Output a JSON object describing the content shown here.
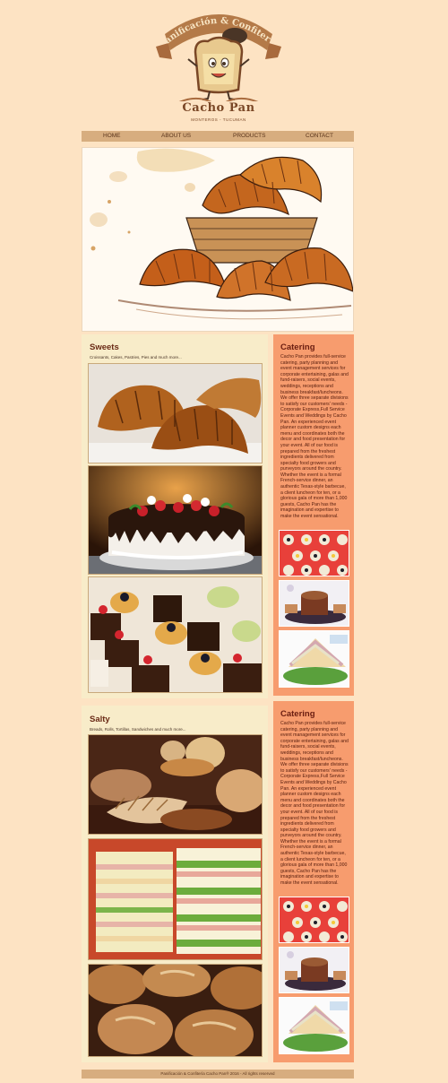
{
  "logo": {
    "arch_text": "Panificación & Confitería",
    "brand": "Cacho Pan",
    "subtitle": "MONTEROS - TUCUMAN"
  },
  "nav": [
    {
      "label": "HOME"
    },
    {
      "label": "ABOUT US"
    },
    {
      "label": "PRODUCTS"
    },
    {
      "label": "CONTACT"
    }
  ],
  "sweets": {
    "title": "Sweets",
    "intro": "Croissants, Cakes, Pastries, Pies and much more...",
    "images": [
      "croissants-photo",
      "cake-photo",
      "pastries-photo"
    ]
  },
  "salty": {
    "title": "Salty",
    "intro": "Breads, Rolls, Tortillas, Sandwiches and much more...",
    "images": [
      "breads-photo",
      "sandwiches-photo",
      "rolls-photo"
    ]
  },
  "catering_1": {
    "title": "Catering",
    "body": "Cacho Pan provides full-service catering, party planning and event management services for corporate entertaining, galas and fund-raisers, social events, weddings, receptions and business breakfast/luncheons. We offer three separate divisions to satisfy our customers' needs - Corporate Express,Full Service Events and Weddings by Cacho Pan. An experienced event planner custom designs each menu and coordinates both the decor and food presentation for your event. All of our food is prepared from the freshest ingredients delivered from specialty food growers and purveyors around the country. Whether the event is a formal French-service dinner, an authentic Texas-style barbecue, a client luncheon for ten, or a glorious gala of more than 1,000 guests, Cacho Pan has the imagination and expertise to make the event sensational."
  },
  "catering_2": {
    "title": "Catering",
    "body": "Cacho Pan provides full-service catering, party planning and event management services for corporate entertaining, galas and fund-raisers, social events, weddings, receptions and business breakfast/luncheons. We offer three separate divisions to satisfy our customers' needs - Corporate Express,Full Service Events and Weddings by Cacho Pan. An experienced event planner custom designs each menu and coordinates both the decor and food presentation for your event. All of our food is prepared from the freshest ingredients delivered from specialty food growers and purveyors around the country. Whether the event is a formal French-service dinner, an authentic Texas-style barbecue, a client luncheon for ten, or a glorious gala of more than 1,000 guests, Cacho Pan has the imagination and expertise to make the event sensational."
  },
  "footer": {
    "text": "Panificación & Confitería Cacho Pan® 2016 - All rights reserved"
  }
}
